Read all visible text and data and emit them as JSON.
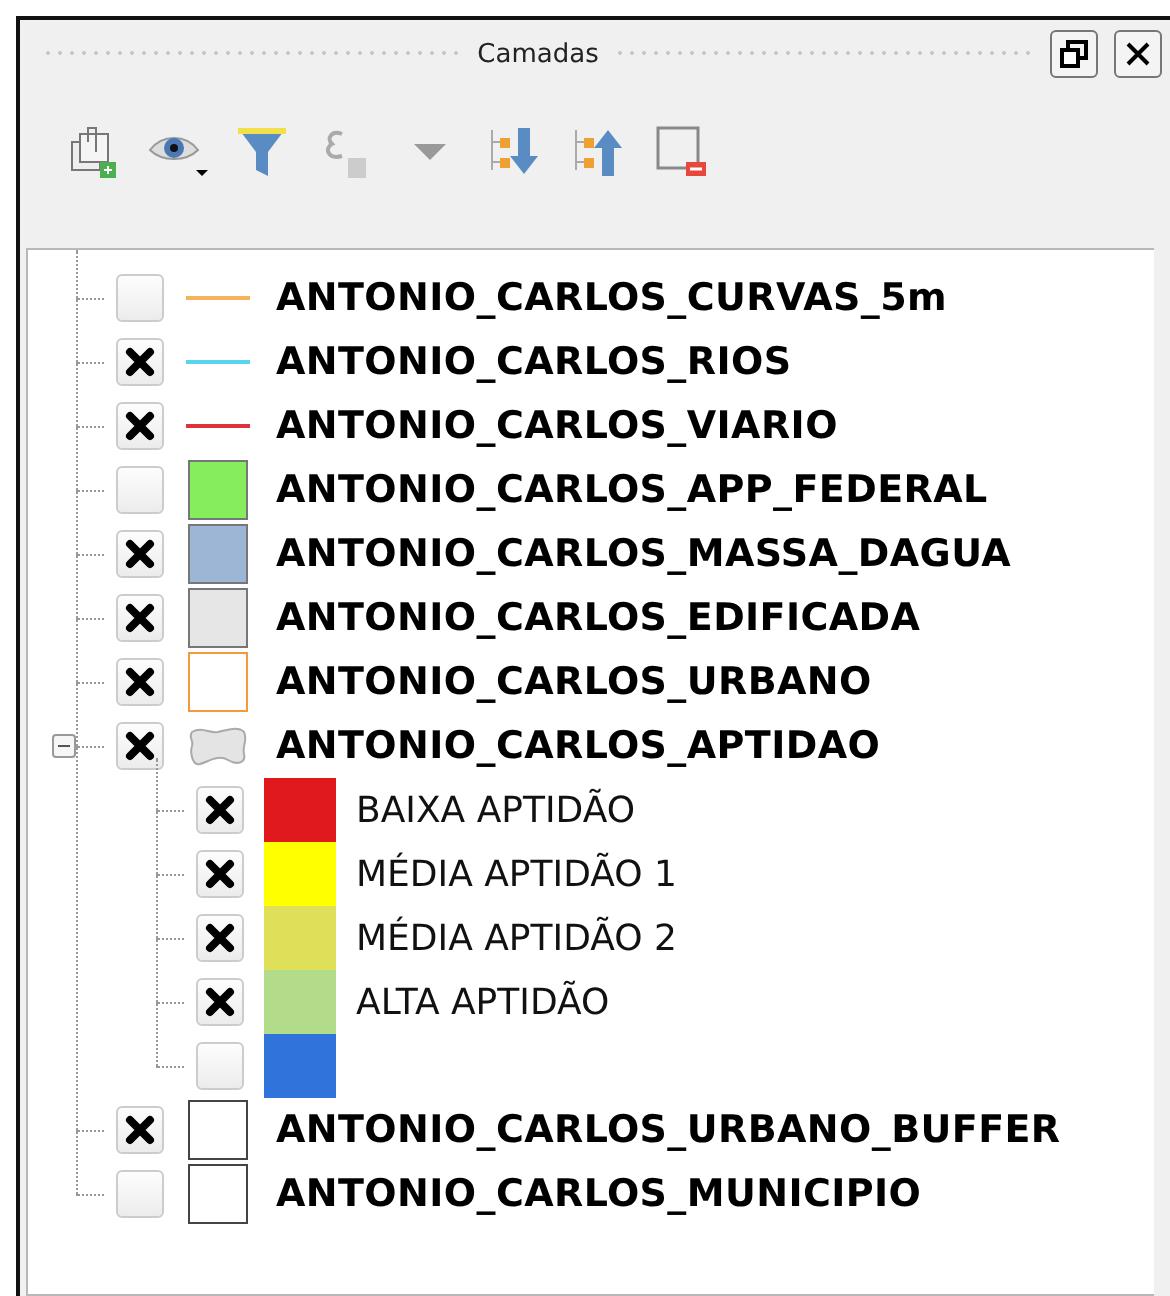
{
  "panel": {
    "title": "Camadas"
  },
  "layers": [
    {
      "name": "ANTONIO_CARLOS_CURVAS_5m",
      "checked": false,
      "symbol": {
        "kind": "line",
        "color": "#f5b25a"
      }
    },
    {
      "name": "ANTONIO_CARLOS_RIOS",
      "checked": true,
      "symbol": {
        "kind": "line",
        "color": "#5ad2f0"
      }
    },
    {
      "name": "ANTONIO_CARLOS_VIARIO",
      "checked": true,
      "symbol": {
        "kind": "line",
        "color": "#e0303a"
      }
    },
    {
      "name": "ANTONIO_CARLOS_APP_FEDERAL",
      "checked": false,
      "symbol": {
        "kind": "fill",
        "color": "#86ee5c"
      }
    },
    {
      "name": "ANTONIO_CARLOS_MASSA_DAGUA",
      "checked": true,
      "symbol": {
        "kind": "fill",
        "color": "#9db6d6"
      }
    },
    {
      "name": "ANTONIO_CARLOS_EDIFICADA",
      "checked": true,
      "symbol": {
        "kind": "fill",
        "color": "#e6e6e6"
      }
    },
    {
      "name": "ANTONIO_CARLOS_URBANO",
      "checked": true,
      "symbol": {
        "kind": "outline",
        "color": "#f59a3c"
      }
    },
    {
      "name": "ANTONIO_CARLOS_APTIDAO",
      "checked": true,
      "expanded": true,
      "symbol": {
        "kind": "classes"
      },
      "children": [
        {
          "name": "BAIXA APTIDÃO",
          "checked": true,
          "color": "#e01a1c"
        },
        {
          "name": "MÉDIA APTIDÃO 1",
          "checked": true,
          "color": "#ffff00"
        },
        {
          "name": "MÉDIA APTIDÃO 2",
          "checked": true,
          "color": "#dfdf5a"
        },
        {
          "name": "ALTA APTIDÃO",
          "checked": true,
          "color": "#b3dc8a"
        },
        {
          "checked": false,
          "color": "#2f73db"
        }
      ]
    },
    {
      "name": "ANTONIO_CARLOS_URBANO_BUFFER",
      "checked": true,
      "symbol": {
        "kind": "outline",
        "color": "#444444"
      }
    },
    {
      "name": "ANTONIO_CARLOS_MUNICIPIO",
      "checked": false,
      "symbol": {
        "kind": "outline",
        "color": "#444444"
      }
    }
  ]
}
